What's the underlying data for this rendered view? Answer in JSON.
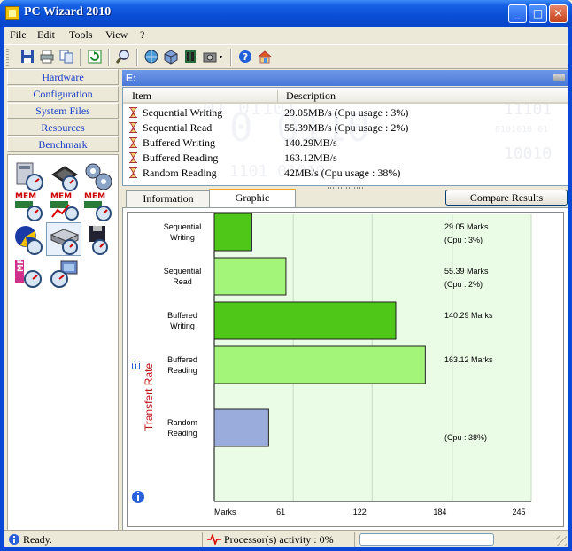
{
  "window": {
    "title": "PC Wizard 2010"
  },
  "menu": [
    "File",
    "Edit",
    "Tools",
    "View",
    "?"
  ],
  "toolbar_icons": [
    "save-icon",
    "print-icon",
    "copy-icon",
    "refresh-icon",
    "search-icon",
    "network-icon",
    "cube-icon",
    "memory-icon",
    "camera-icon",
    "help-icon",
    "home-icon"
  ],
  "sidebar": {
    "items": [
      {
        "label": "Hardware"
      },
      {
        "label": "Configuration"
      },
      {
        "label": "System Files"
      },
      {
        "label": "Resources"
      },
      {
        "label": "Benchmark"
      }
    ],
    "benchmark_icons": [
      {
        "name": "cpu-benchmark-icon",
        "text": ""
      },
      {
        "name": "chip-benchmark-icon",
        "text": ""
      },
      {
        "name": "gears-benchmark-icon",
        "text": ""
      },
      {
        "name": "mem-benchmark-icon",
        "text": "MEM"
      },
      {
        "name": "mem-graph-benchmark-icon",
        "text": "MEM"
      },
      {
        "name": "mem-latency-benchmark-icon",
        "text": "MEM"
      },
      {
        "name": "video-benchmark-icon",
        "text": ""
      },
      {
        "name": "hdd-benchmark-icon",
        "text": ""
      },
      {
        "name": "floppy-benchmark-icon",
        "text": ""
      },
      {
        "name": "mp3-benchmark-icon",
        "text": "MP3"
      },
      {
        "name": "multimedia-benchmark-icon",
        "text": ""
      }
    ]
  },
  "drive_header": "E:",
  "list": {
    "columns": [
      "Item",
      "Description"
    ],
    "rows": [
      {
        "item": "Sequential Writing",
        "description": "29.05MB/s (Cpu usage : 3%)"
      },
      {
        "item": "Sequential Read",
        "description": "55.39MB/s  (Cpu usage : 2%)"
      },
      {
        "item": "Buffered Writing",
        "description": "140.29MB/s"
      },
      {
        "item": "Buffered Reading",
        "description": "163.12MB/s"
      },
      {
        "item": "Random Reading",
        "description": "42MB/s  (Cpu usage : 38%)"
      }
    ]
  },
  "tabs": [
    {
      "label": "Information",
      "active": false
    },
    {
      "label": "Graphic",
      "active": true
    }
  ],
  "compare_button": "Compare Results",
  "chart_data": {
    "type": "bar",
    "orientation": "horizontal",
    "ylabel_drive": "E:",
    "ylabel": "Transfert Rate",
    "xlabel": "Marks",
    "xlim": [
      0,
      245
    ],
    "xticks": [
      "61",
      "122",
      "184",
      "245"
    ],
    "grid": true,
    "categories": [
      "Sequential\nWriting",
      "Sequential\nRead",
      "Buffered\nWriting",
      "Buffered\nReading",
      "Random\nReading"
    ],
    "values": [
      29.05,
      55.39,
      140.29,
      163.12,
      42
    ],
    "colors": [
      "#4ec718",
      "#a3f57a",
      "#4ec718",
      "#a3f57a",
      "#9aacdc"
    ],
    "marks_labels": [
      "29.05 Marks",
      "55.39 Marks",
      "140.29 Marks",
      "163.12 Marks",
      ""
    ],
    "cpu_labels": [
      "(Cpu : 3%)",
      "(Cpu : 2%)",
      "",
      "",
      "(Cpu : 38%)"
    ]
  },
  "status": {
    "ready": "Ready.",
    "processor": "Processor(s) activity : 0%"
  },
  "colors": {
    "titlebar": "#0a4ed6",
    "nav_text": "#1a3fc8",
    "bar_dark": "#4ec718",
    "bar_light": "#a3f57a",
    "bar_blue": "#9aacdc",
    "axis_label": "#c0141c"
  }
}
